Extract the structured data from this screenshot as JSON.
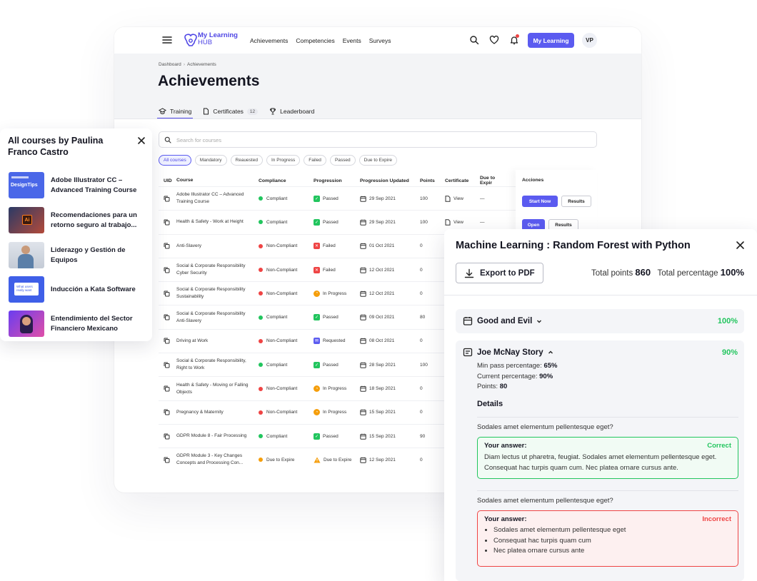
{
  "nav": {
    "logo_line1": "My Learning",
    "logo_line2": "HUB",
    "menu": [
      "Achievements",
      "Competencies",
      "Events",
      "Surveys"
    ],
    "my_learning_button": "My Learning",
    "avatar_initials": "VP"
  },
  "breadcrumb": {
    "root": "Dashboard",
    "current": "Achievements"
  },
  "page_title": "Achievements",
  "tabs": [
    {
      "label": "Training",
      "icon": "graduation-cap-icon",
      "active": true
    },
    {
      "label": "Certificates",
      "icon": "document-icon",
      "badge": "12"
    },
    {
      "label": "Leaderboard",
      "icon": "trophy-icon"
    }
  ],
  "search": {
    "placeholder": "Search for courses"
  },
  "filters": [
    "All courses",
    "Mandatory",
    "Reauested",
    "In Progress",
    "Failed",
    "Passed",
    "Due to Expire"
  ],
  "table": {
    "headers": {
      "uid": "UID",
      "course": "Course",
      "compliance": "Compliance",
      "progression": "Progression",
      "updated": "Progression Updated",
      "points": "Points",
      "certificate": "Certificate",
      "due": "Due to Expir",
      "actions": "Acciones"
    },
    "rows": [
      {
        "course": "Adobe Illustrator CC – Advanced Training Course",
        "compliance": "Compliant",
        "progression": "Passed",
        "date": "29 Sep 2021",
        "points": "100",
        "certificate": "View",
        "due": "—"
      },
      {
        "course": "Health & Safety - Work at Height",
        "compliance": "Compliant",
        "progression": "Passed",
        "date": "29 Sep 2021",
        "points": "100",
        "certificate": "View",
        "due": "—"
      },
      {
        "course": "Anti-Slavery",
        "compliance": "Non-Compliant",
        "progression": "Failed",
        "date": "01 Oct 2021",
        "points": "0"
      },
      {
        "course": "Social & Corporate Responsibility Cyber Security",
        "compliance": "Non-Compliant",
        "progression": "Failed",
        "date": "12 Oct 2021",
        "points": "0"
      },
      {
        "course": "Social & Corporate Responsibility Sustainability",
        "compliance": "Non-Compliant",
        "progression": "In Progress",
        "date": "12 Oct 2021",
        "points": "0"
      },
      {
        "course": "Social & Corporate Responsibility Anti-Slavery",
        "compliance": "Compliant",
        "progression": "Passed",
        "date": "09 Oct 2021",
        "points": "80"
      },
      {
        "course": "Driving at Work",
        "compliance": "Non-Compliant",
        "progression": "Requested",
        "date": "08 Oct 2021",
        "points": "0"
      },
      {
        "course": "Social & Corporate Responsibility, Right to Work",
        "compliance": "Compliant",
        "progression": "Passed",
        "date": "28 Sep 2021",
        "points": "100"
      },
      {
        "course": "Health & Safety - Moving or Falling Objects",
        "compliance": "Non-Compliant",
        "progression": "In Progress",
        "date": "18 Sep 2021",
        "points": "0"
      },
      {
        "course": "Pregnancy & Maternity",
        "compliance": "Non-Compliant",
        "progression": "In Progress",
        "date": "15 Sep 2021",
        "points": "0"
      },
      {
        "course": "GDPR Module 8 - Fair Processing",
        "compliance": "Compliant",
        "progression": "Passed",
        "date": "15 Sep 2021",
        "points": "90"
      },
      {
        "course": "GDPR Module 3 - Key Changes Concepts and Processing Con...",
        "compliance": "Due to Expire",
        "progression": "Due to Expire",
        "date": "12 Sep 2021",
        "points": "0"
      }
    ],
    "actions": {
      "start_now": "Start Now",
      "results": "Results",
      "open": "Open"
    }
  },
  "courses_card": {
    "title": "All courses by Paulina Franco Castro",
    "items": [
      {
        "label": "Adobe Illustrator CC – Advanced Training Course",
        "thumb_text": "DesignTips"
      },
      {
        "label": "Recomendaciones para un retorno seguro al trabajo..."
      },
      {
        "label": "Liderazgo y Gestión de Equipos"
      },
      {
        "label": "Inducción a Kata Software",
        "thumb_text": "What users really want"
      },
      {
        "label": "Entendimiento del Sector Financiero Mexicano"
      }
    ]
  },
  "panel": {
    "title": "Machine Learning : Random Forest with Python",
    "export_label": "Export to PDF",
    "total_points_label": "Total points",
    "total_points": "860",
    "total_percentage_label": "Total percentage",
    "total_percentage": "100%",
    "section1": {
      "title": "Good and Evil",
      "pct": "100%"
    },
    "section2": {
      "title": "Joe McNay Story",
      "pct": "90%",
      "min_pass_label": "Min pass percentage:",
      "min_pass": "65%",
      "current_label": "Current percentage:",
      "current": "90%",
      "points_label": "Points:",
      "points": "80",
      "details_label": "Details"
    },
    "q1": {
      "question": "Sodales amet elementum pellentesque eget?",
      "answer_label": "Your answer:",
      "verdict": "Correct",
      "answer": "Diam lectus ut pharetra, feugiat. Sodales amet elementum pellentesque eget. Consequat hac turpis quam cum. Nec platea ornare cursus ante."
    },
    "q2": {
      "question": "Sodales amet elementum pellentesque eget?",
      "answer_label": "Your answer:",
      "verdict": "Incorrect",
      "answers": [
        "Sodales amet elementum pellentesque eget",
        "Consequat hac turpis quam cum",
        "Nec platea ornare cursus ante"
      ]
    }
  },
  "colors": {
    "accent": "#5b5bf0",
    "green": "#22c55e",
    "red": "#ef4444",
    "orange": "#f59e0b",
    "blue": "#5b5bf0"
  }
}
